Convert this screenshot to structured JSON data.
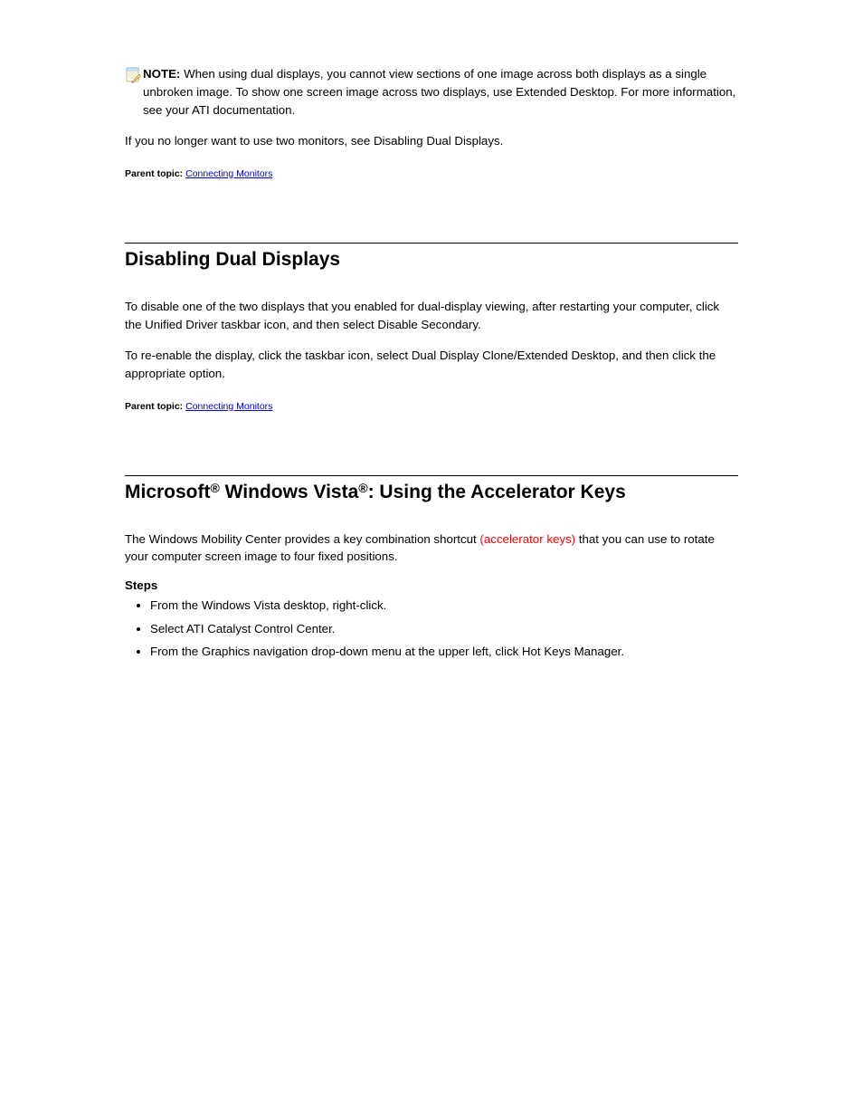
{
  "section1": {
    "note_label": "NOTE:",
    "note_text": "When using dual displays, you cannot view sections of one image across both displays as a single unbroken image. To show one screen image across two displays, use Extended Desktop. For more information, see your ATI documentation.",
    "closing": "If you no longer want to use two monitors, see Disabling Dual Displays.",
    "parent_label": "Parent topic:",
    "parent_value": "Connecting Monitors"
  },
  "section2": {
    "title": "Disabling Dual Displays",
    "p1": "To disable one of the two displays that you enabled for dual-display viewing, after restarting your computer, click the Unified Driver taskbar icon, and then select Disable Secondary.",
    "p2": "To re-enable the display, click the taskbar icon, select Dual Display Clone/Extended Desktop, and then click the appropriate option.",
    "parent_label": "Parent topic:",
    "parent_value": "Connecting Monitors"
  },
  "section3": {
    "title_prefix": "Microsoft",
    "title_reg": "®",
    "title_mid": " Windows Vista",
    "title_suffix": ": Using the Accelerator Keys",
    "intro": "The Windows Mobility Center provides a key combination shortcut",
    "intro_red": " (accelerator keys)",
    "intro_cont": " that you can use to rotate your computer screen image to four fixed positions. ",
    "steps_label": "Steps",
    "steps": [
      "From the Windows Vista desktop, right-click. ",
      "Select ATI Catalyst Control Center. ",
      "From the Graphics navigation drop-down menu at the upper left, click Hot Keys Manager. "
    ]
  }
}
